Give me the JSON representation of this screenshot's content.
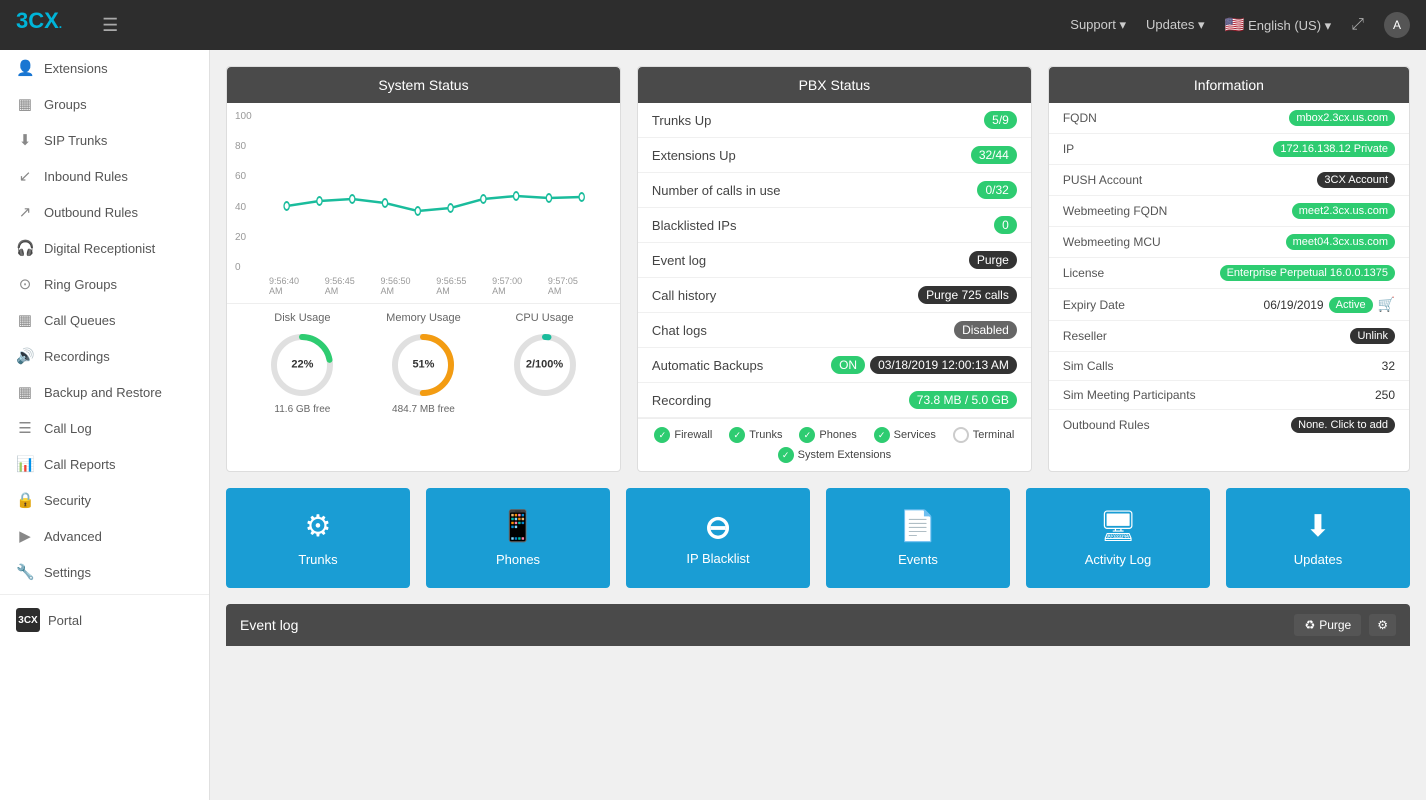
{
  "topnav": {
    "logo": "3CX",
    "logo_sup": ".",
    "hamburger": "☰",
    "support": "Support",
    "updates": "Updates",
    "language": "English (US)",
    "expand_icon": "⤢",
    "user_initial": "A"
  },
  "sidebar": {
    "items": [
      {
        "id": "extensions",
        "label": "Extensions",
        "icon": "👤"
      },
      {
        "id": "groups",
        "label": "Groups",
        "icon": "⊞"
      },
      {
        "id": "sip-trunks",
        "label": "SIP Trunks",
        "icon": "↓"
      },
      {
        "id": "inbound-rules",
        "label": "Inbound Rules",
        "icon": "↙"
      },
      {
        "id": "outbound-rules",
        "label": "Outbound Rules",
        "icon": "↗"
      },
      {
        "id": "digital-receptionist",
        "label": "Digital Receptionist",
        "icon": "🎧"
      },
      {
        "id": "ring-groups",
        "label": "Ring Groups",
        "icon": "🔔"
      },
      {
        "id": "call-queues",
        "label": "Call Queues",
        "icon": "⊞"
      },
      {
        "id": "recordings",
        "label": "Recordings",
        "icon": "🔊"
      },
      {
        "id": "backup-restore",
        "label": "Backup and Restore",
        "icon": "⊞"
      },
      {
        "id": "call-log",
        "label": "Call Log",
        "icon": "☰"
      },
      {
        "id": "call-reports",
        "label": "Call Reports",
        "icon": "📊"
      },
      {
        "id": "security",
        "label": "Security",
        "icon": "🔒"
      },
      {
        "id": "advanced",
        "label": "Advanced",
        "icon": "▶"
      },
      {
        "id": "settings",
        "label": "Settings",
        "icon": "🔧"
      }
    ],
    "portal": {
      "label": "Portal",
      "brand": "3CX"
    }
  },
  "system_status": {
    "title": "System Status",
    "chart": {
      "y_labels": [
        "100",
        "80",
        "60",
        "40",
        "20",
        "0"
      ],
      "x_labels": [
        "9:56:40 AM",
        "9:56:45 AM",
        "9:56:50 AM",
        "9:56:55 AM",
        "9:57:00 AM",
        "9:57:05 AM"
      ]
    },
    "gauges": [
      {
        "label": "Disk Usage",
        "value": "22%",
        "sub": "11.6 GB free",
        "percent": 22,
        "color": "#2ecc71"
      },
      {
        "label": "Memory Usage",
        "value": "51%",
        "sub": "484.7 MB free",
        "percent": 51,
        "color": "#f39c12"
      },
      {
        "label": "CPU Usage",
        "value": "2/100%",
        "sub": "",
        "percent": 2,
        "color": "#1abc9c"
      }
    ]
  },
  "pbx_status": {
    "title": "PBX Status",
    "rows": [
      {
        "label": "Trunks Up",
        "badge": "5/9",
        "badge_type": "green"
      },
      {
        "label": "Extensions Up",
        "badge": "32/44",
        "badge_type": "green"
      },
      {
        "label": "Number of calls in use",
        "badge": "0/32",
        "badge_type": "green"
      },
      {
        "label": "Blacklisted IPs",
        "badge": "0",
        "badge_type": "zero"
      },
      {
        "label": "Event log",
        "badge": "Purge",
        "badge_type": "dark"
      },
      {
        "label": "Call history",
        "badge": "Purge 725 calls",
        "badge_type": "dark"
      },
      {
        "label": "Chat logs",
        "badge": "Disabled",
        "badge_type": "disabled"
      },
      {
        "label": "Automatic Backups",
        "badge1": "ON",
        "badge1_type": "on",
        "badge2": "03/18/2019 12:00:13 AM",
        "badge2_type": "dark"
      },
      {
        "label": "Recording",
        "badge": "73.8 MB / 5.0 GB",
        "badge_type": "recording"
      }
    ],
    "status_icons": [
      {
        "label": "Firewall",
        "active": true
      },
      {
        "label": "Trunks",
        "active": true
      },
      {
        "label": "Phones",
        "active": true
      },
      {
        "label": "Services",
        "active": true
      },
      {
        "label": "Terminal",
        "active": false
      },
      {
        "label": "System Extensions",
        "active": true
      }
    ]
  },
  "information": {
    "title": "Information",
    "rows": [
      {
        "label": "FQDN",
        "value": "mbox2.3cx.us.com",
        "type": "tag_green"
      },
      {
        "label": "IP",
        "value": "172.16.138.12 Private",
        "type": "tag_green"
      },
      {
        "label": "PUSH Account",
        "value": "3CX Account",
        "type": "tag_dark"
      },
      {
        "label": "Webmeeting FQDN",
        "value": "meet2.3cx.us.com",
        "type": "tag_green"
      },
      {
        "label": "Webmeeting MCU",
        "value": "meet04.3cx.us.com",
        "type": "tag_green"
      },
      {
        "label": "License",
        "value": "Enterprise Perpetual 16.0.0.1375",
        "type": "tag_license"
      },
      {
        "label": "Expiry Date",
        "value": "06/19/2019",
        "value2": "Active",
        "type": "mixed"
      },
      {
        "label": "Reseller",
        "value": "Unlink",
        "type": "tag_unlink"
      },
      {
        "label": "Sim Calls",
        "value": "32",
        "type": "plain"
      },
      {
        "label": "Sim Meeting Participants",
        "value": "250",
        "type": "plain"
      },
      {
        "label": "Outbound Rules",
        "value": "None. Click to add",
        "type": "tag_dark"
      }
    ]
  },
  "tiles": [
    {
      "id": "trunks",
      "label": "Trunks",
      "icon": "⚙"
    },
    {
      "id": "phones",
      "label": "Phones",
      "icon": "📱"
    },
    {
      "id": "ip-blacklist",
      "label": "IP Blacklist",
      "icon": "⊖"
    },
    {
      "id": "events",
      "label": "Events",
      "icon": "📄"
    },
    {
      "id": "activity-log",
      "label": "Activity Log",
      "icon": "🖥"
    },
    {
      "id": "updates",
      "label": "Updates",
      "icon": "⬇"
    }
  ],
  "event_log": {
    "title": "Event log",
    "purge_label": "Purge",
    "gear_icon": "⚙"
  }
}
